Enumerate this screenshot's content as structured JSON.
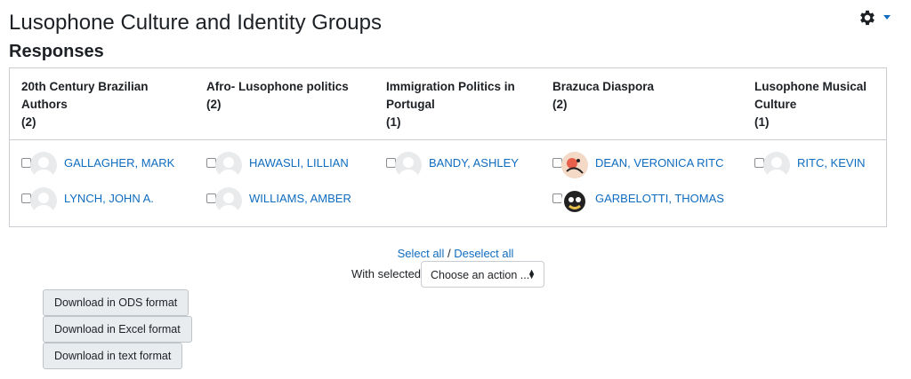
{
  "header": {
    "title": "Lusophone Culture and Identity Groups",
    "subtitle": "Responses"
  },
  "columns": [
    {
      "title": "20th Century Brazilian Authors",
      "count": "(2)",
      "responses": [
        {
          "name": "GALLAGHER, MARK",
          "avatar": "default"
        },
        {
          "name": "LYNCH, JOHN A.",
          "avatar": "default"
        }
      ]
    },
    {
      "title": "Afro- Lusophone politics",
      "count": "(2)",
      "responses": [
        {
          "name": "HAWASLI, LILLIAN",
          "avatar": "default"
        },
        {
          "name": "WILLIAMS, AMBER",
          "avatar": "default"
        }
      ]
    },
    {
      "title": "Immigration Politics in Portugal",
      "count": "(1)",
      "responses": [
        {
          "name": "BANDY, ASHLEY",
          "avatar": "default"
        }
      ]
    },
    {
      "title": "Brazuca Diaspora",
      "count": "(2)",
      "responses": [
        {
          "name": "DEAN, VERONICA RITC",
          "avatar": "cartoon"
        },
        {
          "name": "GARBELOTTI, THOMAS",
          "avatar": "cartoon"
        }
      ]
    },
    {
      "title": "Lusophone Musical Culture",
      "count": "(1)",
      "responses": [
        {
          "name": "RITC, KEVIN",
          "avatar": "default"
        }
      ]
    }
  ],
  "controls": {
    "select_all": "Select all",
    "separator": "/",
    "deselect_all": "Deselect all",
    "with_selected": "With selected",
    "action_select": "Choose an action ..."
  },
  "downloads": {
    "ods": "Download in ODS format",
    "excel": "Download in Excel format",
    "text": "Download in text format"
  },
  "colors": {
    "link": "#0f6cbf",
    "border": "#c9ccd0",
    "button_bg": "#e9ecef"
  }
}
